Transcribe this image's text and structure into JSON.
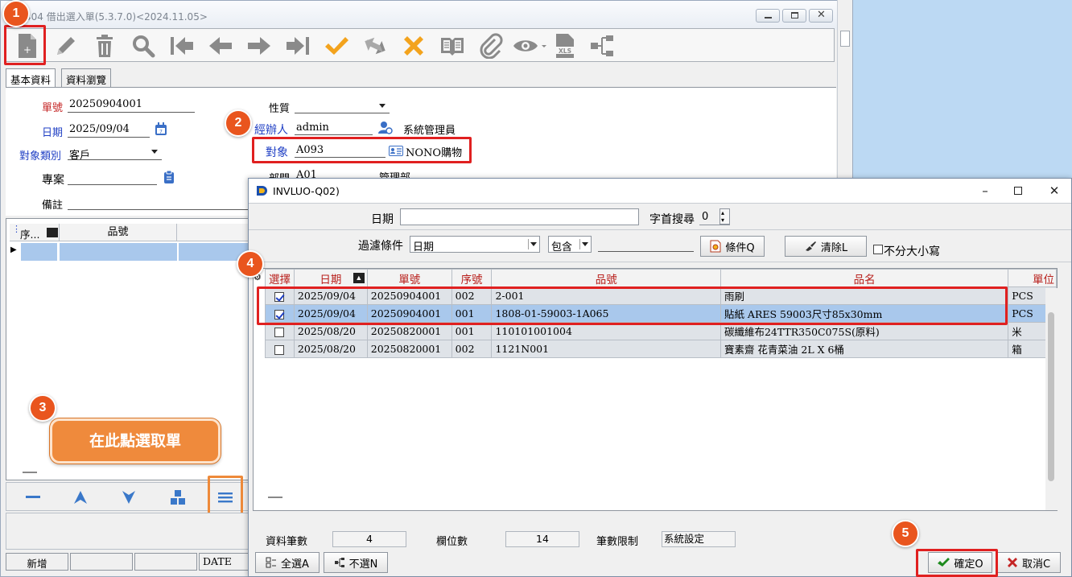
{
  "main_window": {
    "title": "404 借出選入單(5.3.7.0)<2024.11.05>",
    "toolbar_icons": [
      "new-document-icon",
      "edit-pencil-icon",
      "delete-trash-icon",
      "search-icon",
      "first-record-icon",
      "previous-record-icon",
      "next-record-icon",
      "last-record-icon",
      "confirm-check-icon",
      "refresh-icon",
      "cancel-x-icon",
      "book-icon",
      "attachment-clip-icon",
      "view-eye-icon",
      "excel-export-icon",
      "tree-structure-icon"
    ],
    "tabs": [
      "基本資料",
      "資料瀏覽"
    ],
    "form": {
      "order_no_label": "單號",
      "order_no": "20250904001",
      "date_label": "日期",
      "date": "2025/09/04",
      "target_type_label": "對象類別",
      "target_type": "客戶",
      "project_label": "專案",
      "project": "",
      "note_label": "備註",
      "nature_label": "性質",
      "nature": "",
      "handler_label": "經辦人",
      "handler": "admin",
      "handler_name": "系統管理員",
      "target_label": "對象",
      "target": "A093",
      "target_name": "NONO購物",
      "dept_label": "部門",
      "dept": "A01",
      "dept_name": "管理部"
    },
    "grid": {
      "col_seq": "序...",
      "col_item": "品號"
    },
    "status": {
      "mode": "新增",
      "field": "DATE"
    }
  },
  "dialog": {
    "title": "INVLUO-Q02)",
    "date_label": "日期",
    "date_value": "",
    "prefix_search_label": "字首搜尋",
    "prefix_search_value": "0",
    "filter_label": "過濾條件",
    "filter_field": "日期",
    "filter_op": "包含",
    "filter_value": "",
    "condition_button": "條件Q",
    "clear_button": "清除L",
    "case_insensitive_label": "不分大小寫",
    "columns": [
      "選擇",
      "日期",
      "單號",
      "序號",
      "品號",
      "品名",
      "單位"
    ],
    "rows": [
      {
        "checked": true,
        "date": "2025/09/04",
        "order_no": "20250904001",
        "seq": "002",
        "item_no": "2-001",
        "item_name": "雨刷",
        "unit": "PCS"
      },
      {
        "checked": true,
        "date": "2025/09/04",
        "order_no": "20250904001",
        "seq": "001",
        "item_no": "1808-01-59003-1A065",
        "item_name": "貼紙  ARES 59003尺寸85x30mm",
        "unit": "PCS"
      },
      {
        "checked": false,
        "date": "2025/08/20",
        "order_no": "20250820001",
        "seq": "001",
        "item_no": "110101001004",
        "item_name": "碳纖維布24TTR350C075S(原料)",
        "unit": "米"
      },
      {
        "checked": false,
        "date": "2025/08/20",
        "order_no": "20250820001",
        "seq": "002",
        "item_no": "1121N001",
        "item_name": "寶素齋  花青菜油  2L X 6桶",
        "unit": "箱"
      }
    ],
    "record_count_label": "資料筆數",
    "record_count": "4",
    "field_count_label": "欄位數",
    "field_count": "14",
    "limit_label": "筆數限制",
    "limit_value": "系統設定",
    "select_all_button": "全選A",
    "select_none_button": "不選N",
    "ok_button": "確定O",
    "cancel_button": "取消C"
  },
  "annotations": {
    "step1": "1",
    "step2": "2",
    "step3": "3",
    "step4": "4",
    "step5": "5",
    "callout_text": "在此點選取單",
    "badge_color": "#e9551e",
    "highlight_color": "#e02020",
    "callout_color": "#ef8a3c"
  }
}
